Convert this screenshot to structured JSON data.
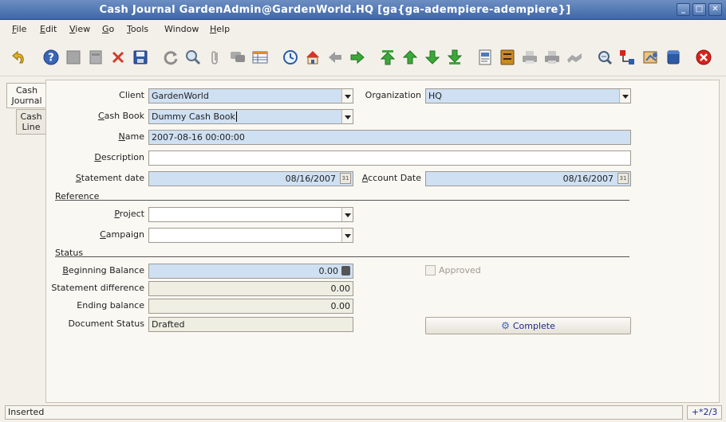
{
  "window": {
    "title": "Cash Journal  GardenAdmin@GardenWorld.HQ [ga{ga-adempiere-adempiere}]",
    "minimize": "_",
    "maximize": "□",
    "close": "✕"
  },
  "menu": [
    {
      "mnemonic": "F",
      "rest": "ile"
    },
    {
      "mnemonic": "E",
      "rest": "dit"
    },
    {
      "mnemonic": "V",
      "rest": "iew"
    },
    {
      "mnemonic": "G",
      "rest": "o"
    },
    {
      "mnemonic": "T",
      "rest": "ools"
    },
    {
      "mnemonic": "",
      "rest": "Window"
    },
    {
      "mnemonic": "H",
      "rest": "elp"
    }
  ],
  "toolbar_icons": [
    "undo-icon",
    "help-icon",
    "new-icon",
    "copy-icon",
    "delete-icon",
    "save-icon",
    "refresh-icon",
    "find-icon",
    "attachment-icon",
    "chat-icon",
    "grid-toggle-icon",
    "history-icon",
    "home-icon",
    "previous-icon",
    "next-icon",
    "first-record-icon",
    "previous-record-icon",
    "next-record-icon",
    "last-record-icon",
    "report-icon",
    "archive-icon",
    "print-preview-icon",
    "print-icon",
    "workflow-icon",
    "zoom-across-icon",
    "active-workflows-icon",
    "request-icon",
    "product-info-icon",
    "exit-icon"
  ],
  "tabs": {
    "cash_journal": "Cash\nJournal",
    "cash_line": "Cash\nLine"
  },
  "form": {
    "client": {
      "label": "Client",
      "value": "GardenWorld"
    },
    "organization": {
      "label": "Organization",
      "value": "HQ"
    },
    "cash_book": {
      "label_mn": "C",
      "label_rest": "ash Book",
      "value": "Dummy Cash Book"
    },
    "name": {
      "label_mn": "N",
      "label_rest": "ame",
      "value": "2007-08-16 00:00:00"
    },
    "description": {
      "label_mn": "D",
      "label_rest": "escription",
      "value": ""
    },
    "statement_date": {
      "label_mn": "S",
      "label_rest": "tatement date",
      "value": "08/16/2007"
    },
    "account_date": {
      "label_mn": "A",
      "label_rest": "ccount Date",
      "value": "08/16/2007"
    },
    "reference_section": {
      "label_mn": "R",
      "label_rest": "eference"
    },
    "project": {
      "label_mn": "P",
      "label_rest": "roject",
      "value": ""
    },
    "campaign": {
      "label_mn": "C",
      "label_rest": "ampaign",
      "value": ""
    },
    "status_section": {
      "label_mn": "S",
      "label_rest": "tatus"
    },
    "beginning_balance": {
      "label_mn": "B",
      "label_rest": "eginning Balance",
      "value": "0.00"
    },
    "statement_difference": {
      "label": "Statement difference",
      "value": "0.00"
    },
    "ending_balance": {
      "label": "Ending balance",
      "value": "0.00"
    },
    "document_status": {
      "label": "Document Status",
      "value": "Drafted"
    },
    "approved": {
      "label": "Approved",
      "checked": false
    },
    "complete_button": "Complete"
  },
  "status": {
    "message": "Inserted",
    "record_count": "+*2/3"
  },
  "colors": {
    "required_field": "#cfe0f3",
    "readonly_field": "#efeee3",
    "titlebar": "#4a72b0"
  }
}
